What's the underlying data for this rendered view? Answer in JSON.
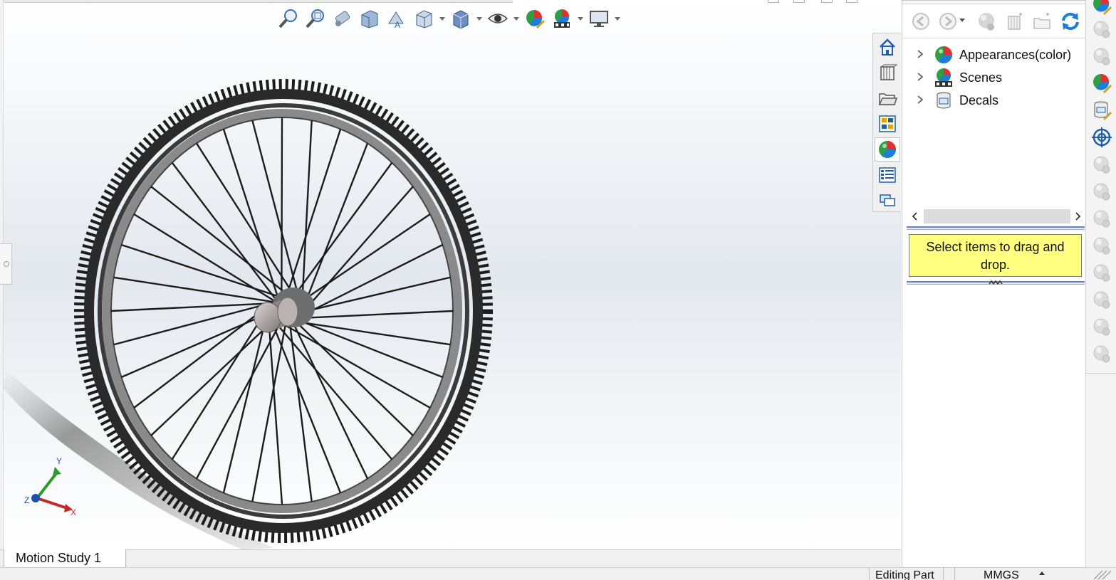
{
  "viewport": {
    "heads_up_toolbar": [
      {
        "name": "zoom-to-fit-icon",
        "dropdown": false
      },
      {
        "name": "zoom-to-area-icon",
        "dropdown": false
      },
      {
        "name": "previous-view-icon",
        "dropdown": false
      },
      {
        "name": "section-view-icon",
        "dropdown": false
      },
      {
        "name": "dynamic-annotation-icon",
        "dropdown": false
      },
      {
        "name": "view-orientation-icon",
        "dropdown": true
      },
      {
        "name": "display-style-icon",
        "dropdown": true
      },
      {
        "name": "hide-show-items-icon",
        "dropdown": true
      },
      {
        "name": "edit-appearance-icon",
        "dropdown": false
      },
      {
        "name": "apply-scene-icon",
        "dropdown": true
      },
      {
        "name": "view-settings-icon",
        "dropdown": true
      }
    ],
    "triad": {
      "x_label": "X",
      "y_label": "Y",
      "z_label": "Z"
    }
  },
  "tab_strip": {
    "tabs": [
      {
        "name": "solidworks-resources-icon",
        "active": false
      },
      {
        "name": "design-library-icon",
        "active": false
      },
      {
        "name": "file-explorer-icon",
        "active": false
      },
      {
        "name": "view-palette-icon",
        "active": false
      },
      {
        "name": "appearances-scenes-decals-icon",
        "active": true
      },
      {
        "name": "custom-properties-icon",
        "active": false
      },
      {
        "name": "forum-icon",
        "active": false
      }
    ]
  },
  "bottom_tabs": {
    "motion_study": "Motion Study 1"
  },
  "status_bar": {
    "editing": "Editing Part",
    "units": "MMGS"
  },
  "task_pane": {
    "toolbar": [
      "back-icon",
      "forward-icon",
      "appearance-ball-icon",
      "add-folder-icon",
      "new-folder-icon",
      "refresh-icon"
    ],
    "tree": [
      {
        "label": "Appearances(color)",
        "icon": "appearances-icon"
      },
      {
        "label": "Scenes",
        "icon": "scenes-icon"
      },
      {
        "label": "Decals",
        "icon": "decals-icon"
      }
    ],
    "hint": "Select items to drag and drop."
  },
  "side_toolbar": {
    "buttons": [
      "appearance-edit-icon",
      "copy-appearance-icon",
      "paste-appearance-icon",
      "edit-scene-icon",
      "edit-decal-icon",
      "camera-target-icon",
      "light-sphere-icon",
      "render-region-icon",
      "render-icon",
      "final-render-icon",
      "batch-render-icon",
      "render-settings-icon",
      "schedule-render-icon",
      "recall-render-icon"
    ]
  },
  "colors": {
    "accent_blue": "#1f5fa8",
    "hint_yellow": "#ffff80",
    "separator_blue": "#6b84b6"
  }
}
